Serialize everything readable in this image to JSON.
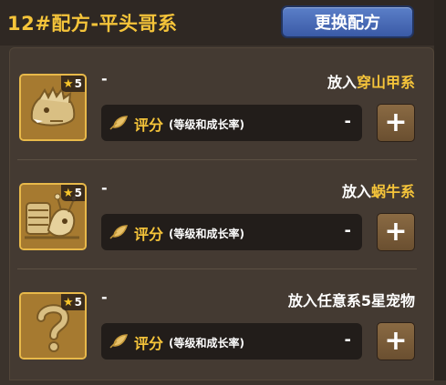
{
  "header": {
    "title": "12#配方-平头哥系",
    "swap_button": "更换配方"
  },
  "slots": [
    {
      "stars": "5",
      "name": "-",
      "put_prefix": "放入",
      "put_target": "穿山甲系",
      "score_label": "评分",
      "score_note": "(等级和成长率)",
      "score_value": "-",
      "plus": "+",
      "icon": "pangolin-icon"
    },
    {
      "stars": "5",
      "name": "-",
      "put_prefix": "放入",
      "put_target": "蜗牛系",
      "score_label": "评分",
      "score_note": "(等级和成长率)",
      "score_value": "-",
      "plus": "+",
      "icon": "snail-icon"
    },
    {
      "stars": "5",
      "name": "-",
      "put_prefix": "",
      "put_target": "放入任意系5星宠物",
      "score_label": "评分",
      "score_note": "(等级和成长率)",
      "score_value": "-",
      "plus": "+",
      "icon": "question-mark-icon"
    }
  ],
  "colors": {
    "accent": "#f5c43a",
    "panel": "#443a32",
    "button_blue": "#4a6cb8",
    "slot_border": "#e8b94a"
  }
}
